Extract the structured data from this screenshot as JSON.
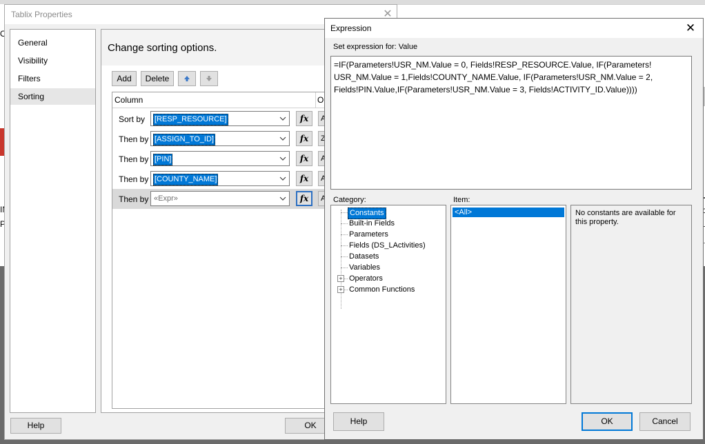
{
  "background": {
    "left_fragments": [
      "O",
      "IN",
      "PI"
    ],
    "right_fragments": [
      "so",
      "S"
    ]
  },
  "tablix": {
    "title": "Tablix Properties",
    "nav": [
      {
        "label": "General"
      },
      {
        "label": "Visibility"
      },
      {
        "label": "Filters"
      },
      {
        "label": "Sorting"
      }
    ],
    "heading": "Change sorting options.",
    "toolbar": {
      "add": "Add",
      "delete": "Delete"
    },
    "columns": {
      "column": "Column",
      "order": "Or"
    },
    "rows": [
      {
        "label": "Sort by",
        "value": "[RESP_RESOURCE]",
        "order": "A"
      },
      {
        "label": "Then by",
        "value": "[ASSIGN_TO_ID]",
        "order": "Z"
      },
      {
        "label": "Then by",
        "value": "[PIN]",
        "order": "A"
      },
      {
        "label": "Then by",
        "value": "[COUNTY_NAME]",
        "order": "A"
      },
      {
        "label": "Then by",
        "value": "«Expr»",
        "order": "A"
      }
    ],
    "fx_label": "fx",
    "help": "Help",
    "ok": "OK"
  },
  "expression": {
    "title": "Expression",
    "set_label": "Set expression for: Value",
    "text": "=IF(Parameters!USR_NM.Value = 0, Fields!RESP_RESOURCE.Value, IF(Parameters!\nUSR_NM.Value = 1,Fields!COUNTY_NAME.Value, IF(Parameters!USR_NM.Value = 2,\nFields!PIN.Value,IF(Parameters!USR_NM.Value = 3, Fields!ACTIVITY_ID.Value))))",
    "category_label": "Category:",
    "item_label": "Item:",
    "categories": [
      {
        "label": "Constants"
      },
      {
        "label": "Built-in Fields"
      },
      {
        "label": "Parameters"
      },
      {
        "label": "Fields (DS_LActivities)"
      },
      {
        "label": "Datasets"
      },
      {
        "label": "Variables"
      },
      {
        "label": "Operators"
      },
      {
        "label": "Common Functions"
      }
    ],
    "items": [
      "<All>"
    ],
    "description": "No constants are available for this property.",
    "help": "Help",
    "ok": "OK",
    "cancel": "Cancel"
  }
}
